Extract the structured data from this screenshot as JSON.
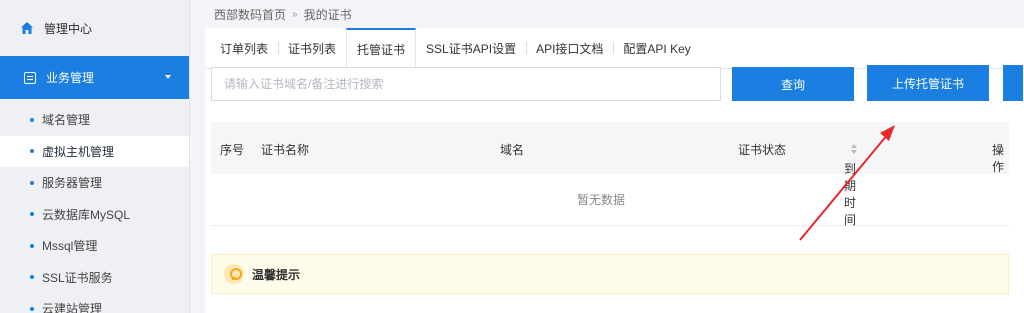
{
  "sidebar": {
    "home_label": "管理中心",
    "section_label": "业务管理",
    "items": [
      {
        "label": "域名管理"
      },
      {
        "label": "虚拟主机管理"
      },
      {
        "label": "服务器管理"
      },
      {
        "label": "云数据库MySQL"
      },
      {
        "label": "Mssql管理"
      },
      {
        "label": "SSL证书服务"
      },
      {
        "label": "云建站管理"
      }
    ],
    "current_index": 1
  },
  "breadcrumb": {
    "home": "西部数码首页",
    "separator": "»",
    "current": "我的证书"
  },
  "tabs": [
    {
      "label": "订单列表",
      "active": false
    },
    {
      "label": "证书列表",
      "active": false
    },
    {
      "label": "托管证书",
      "active": true
    },
    {
      "label": "SSL证书API设置",
      "active": false
    },
    {
      "label": "API接口文档",
      "active": false
    },
    {
      "label": "配置API Key",
      "active": false
    }
  ],
  "search": {
    "placeholder": "请输入证书域名/备注进行搜索",
    "value": "",
    "query_label": "查询",
    "upload_label": "上传托管证书"
  },
  "table": {
    "columns": [
      "序号",
      "证书名称",
      "域名",
      "证书状态",
      "到期时间",
      "操作"
    ],
    "empty_text": "暂无数据"
  },
  "notice": {
    "title": "温馨提示"
  },
  "colors": {
    "accent": "#1a7fe0",
    "annotation_arrow": "#e8262b",
    "notice_bg": "#fffbe9"
  }
}
